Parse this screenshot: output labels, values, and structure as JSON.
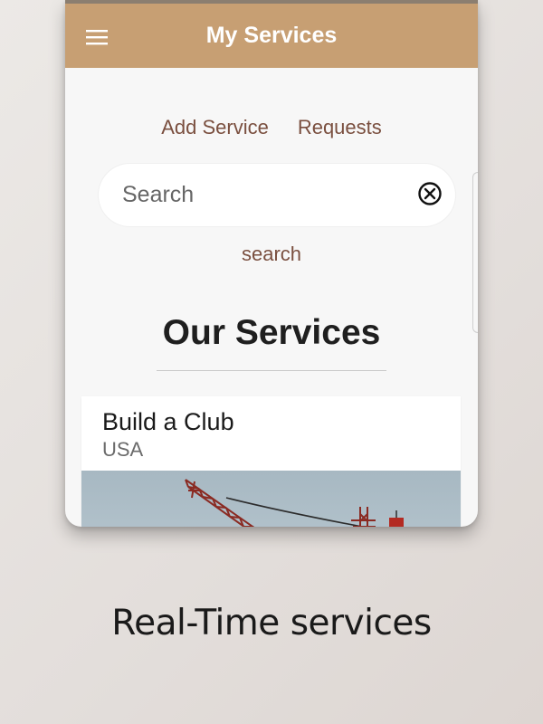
{
  "appbar": {
    "title": "My Services",
    "menu_icon": "hamburger-menu-icon",
    "color": "#c79f73"
  },
  "actions": {
    "add_service": "Add Service",
    "requests": "Requests"
  },
  "search": {
    "placeholder": "Search",
    "value": "",
    "clear_icon": "clear-circle-icon",
    "button_label": "search"
  },
  "section": {
    "title": "Our Services"
  },
  "services": [
    {
      "title": "Build a Club",
      "location": "USA",
      "image": "construction-crane-photo"
    }
  ],
  "caption": "Real-Time services",
  "colors": {
    "link": "#7a4f3f",
    "background": "#f7f7f7"
  }
}
